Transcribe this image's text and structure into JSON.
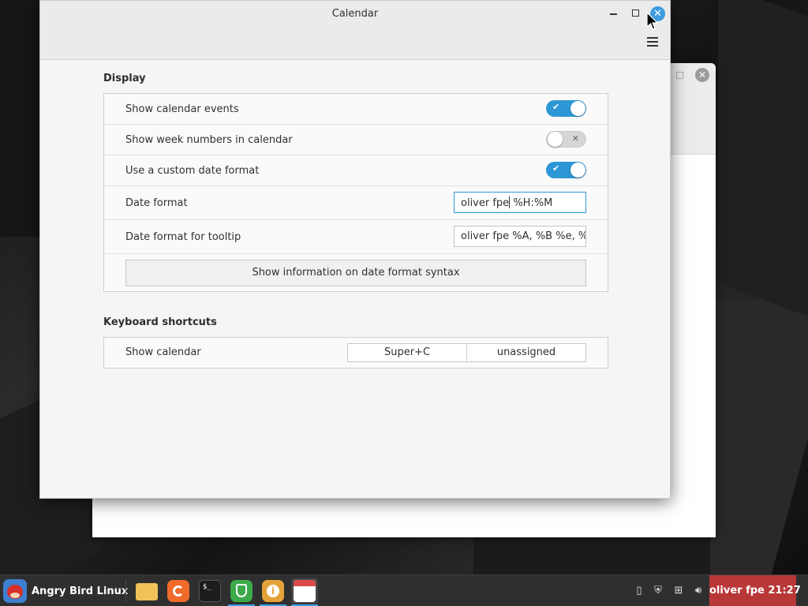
{
  "window": {
    "title": "Calendar",
    "controls": {
      "minimize": "minimize",
      "maximize": "maximize",
      "close": "close"
    }
  },
  "display": {
    "section_title": "Display",
    "show_events": {
      "label": "Show calendar events",
      "enabled": true
    },
    "week_numbers": {
      "label": "Show week numbers in calendar",
      "enabled": false
    },
    "custom_format": {
      "label": "Use a custom date format",
      "enabled": true
    },
    "date_format": {
      "label": "Date format",
      "value_before_caret": "oliver fpe",
      "value_after_caret": " %H:%M"
    },
    "tooltip_format": {
      "label": "Date format for tooltip",
      "value": "oliver fpe %A, %B %e, %H"
    },
    "syntax_button": "Show information on date format syntax"
  },
  "shortcuts": {
    "section_title": "Keyboard shortcuts",
    "show_calendar": {
      "label": "Show calendar",
      "primary": "Super+C",
      "secondary": "unassigned"
    }
  },
  "taskbar": {
    "menu_label": "Angry Bird Linux",
    "clock": "oliver fpe 21:27",
    "launchers": [
      "file-manager",
      "firefox",
      "terminal",
      "security",
      "info",
      "calendar"
    ]
  },
  "colors": {
    "accent": "#2d97d6",
    "close_button": "#3d9de0",
    "clock_bg": "#b83838",
    "taskbar_bg": "#2f2f2f"
  }
}
